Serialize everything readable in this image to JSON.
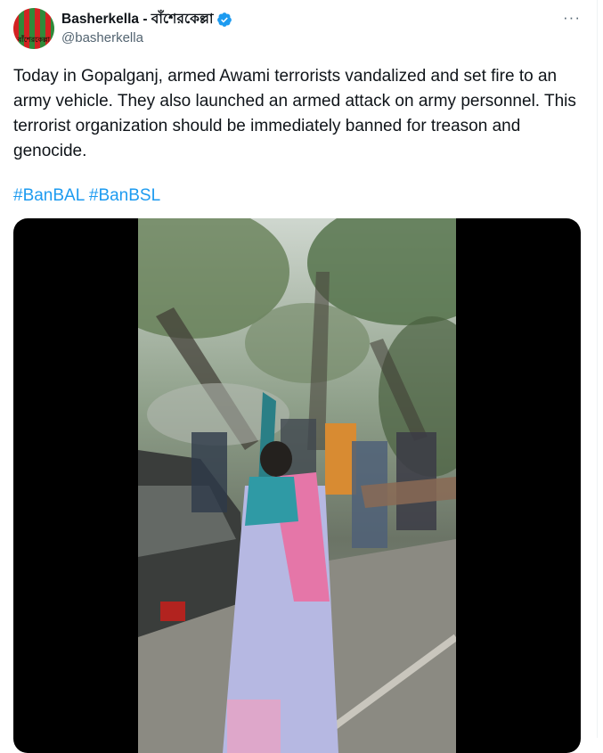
{
  "author": {
    "display_name": "Basherkella - বাঁশেরকেল্লা",
    "handle": "@basherkella",
    "avatar_text": "বাঁশেরকেল্লা",
    "verified_icon": "verified-badge-icon",
    "verified_color": "#1d9bf0"
  },
  "more_icon": "more-options-icon",
  "tweet": {
    "text": "Today in Gopalganj, armed Awami terrorists vandalized and set fire to an army vehicle. They also launched an armed attack on army personnel. This terrorist organization should be immediately banned for treason and genocide.",
    "hashtags": [
      "#BanBAL",
      "#BanBSL"
    ],
    "link_color": "#1d9bf0"
  },
  "media": {
    "type": "video",
    "background": "#000000"
  }
}
